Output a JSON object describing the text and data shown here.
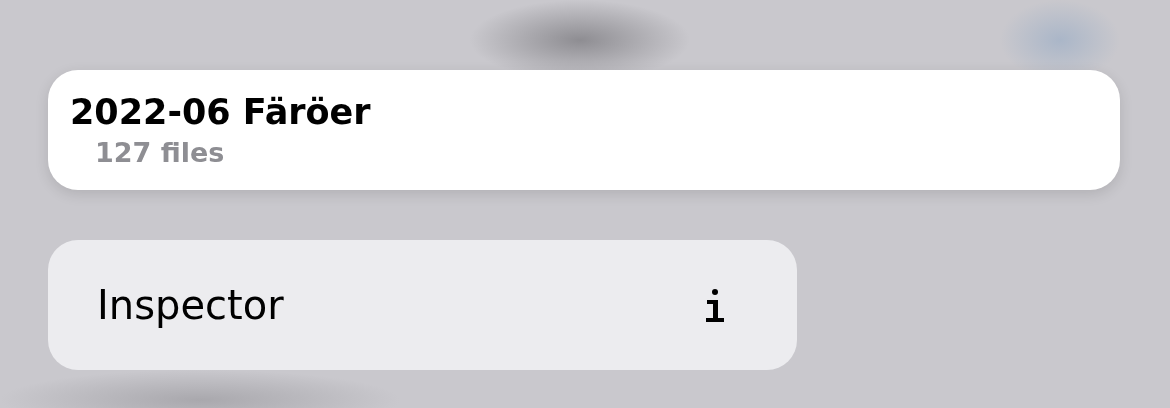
{
  "folder": {
    "title": "2022-06 Färöer",
    "subtitle": "127 files"
  },
  "menu": {
    "items": [
      {
        "label": "Inspector"
      }
    ]
  }
}
